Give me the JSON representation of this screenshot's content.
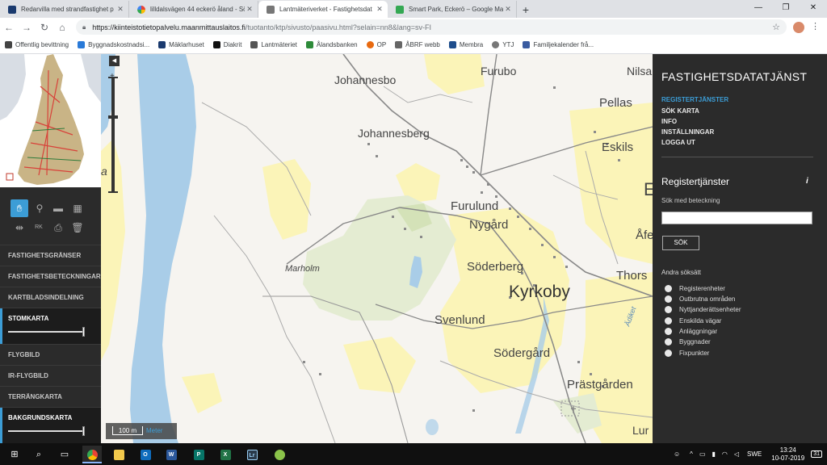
{
  "browser": {
    "tabs": [
      {
        "title": "Redarvilla med strandfastighet p",
        "fav_color": "#1a3a6e",
        "active": false
      },
      {
        "title": "lilldalsvägen 44 eckerö åland - Sö",
        "fav_color": "#ffffff",
        "active": false
      },
      {
        "title": "Lantmäteriverket - Fastighetsdat",
        "fav_color": "#555555",
        "active": true
      },
      {
        "title": "Smart Park, Eckerö – Google Ma",
        "fav_color": "#34a853",
        "active": false
      }
    ],
    "new_tab": "+",
    "url_host": "https://kiinteistotietopalvelu.maanmittauslaitos.fi",
    "url_path": "/tuotanto/ktp/sivusto/paasivu.html?selain=nn8&lang=sv-FI",
    "bookmarks": [
      {
        "label": "Offentlig bevittning",
        "color": "#444444"
      },
      {
        "label": "Byggnadskostnadsi...",
        "color": "#2a7ad8"
      },
      {
        "label": "Mäklarhuset",
        "color": "#1a3a6e"
      },
      {
        "label": "Diakrit",
        "color": "#111111"
      },
      {
        "label": "Lantmäteriet",
        "color": "#555555"
      },
      {
        "label": "Ålandsbanken",
        "color": "#2e8b3a"
      },
      {
        "label": "OP",
        "color": "#e86a10"
      },
      {
        "label": "ÅBRF webb",
        "color": "#666666"
      },
      {
        "label": "Membra",
        "color": "#1e4d8c"
      },
      {
        "label": "YTJ",
        "color": "#777777"
      },
      {
        "label": "Familjekalender frå...",
        "color": "#3a5ba0"
      }
    ]
  },
  "left_panel": {
    "layers": [
      {
        "label": "FASTIGHETSGRÄNSER",
        "on": false
      },
      {
        "label": "FASTIGHETSBETECKNINGAR",
        "on": false
      },
      {
        "label": "KARTBLADSINDELNING",
        "on": false
      },
      {
        "label": "STOMKARTA",
        "on": true
      },
      {
        "label": "FLYGBILD",
        "on": false
      },
      {
        "label": "IR-FLYGBILD",
        "on": false
      },
      {
        "label": "TERRÄNGKARTA",
        "on": false
      },
      {
        "label": "BAKGRUNDSKARTA",
        "on": true
      }
    ],
    "tool_rk": "RK"
  },
  "map": {
    "places": [
      {
        "name": "Johannesbo",
        "style": "normal"
      },
      {
        "name": "Furubo",
        "style": "normal"
      },
      {
        "name": "Nilsa",
        "style": "normal"
      },
      {
        "name": "Pellas",
        "style": "normal"
      },
      {
        "name": "Johannesberg",
        "style": "normal"
      },
      {
        "name": "Eskils",
        "style": "normal"
      },
      {
        "name": "Furulund",
        "style": "normal"
      },
      {
        "name": "Nygård",
        "style": "normal"
      },
      {
        "name": "Åfe",
        "style": "normal"
      },
      {
        "name": "Marholm",
        "style": "italic"
      },
      {
        "name": "Söderberg",
        "style": "normal"
      },
      {
        "name": "Thors",
        "style": "normal"
      },
      {
        "name": "Kyrkoby",
        "style": "big"
      },
      {
        "name": "Svenlund",
        "style": "normal"
      },
      {
        "name": "Södergård",
        "style": "normal"
      },
      {
        "name": "Prästgården",
        "style": "normal"
      },
      {
        "name": "Lur",
        "style": "normal"
      },
      {
        "name": "a",
        "style": "normal"
      },
      {
        "name": "E",
        "style": "normal"
      },
      {
        "name": "Ädiket",
        "style": "italic"
      }
    ],
    "scale_label": "100 m",
    "scale_unit": "Meter"
  },
  "right_panel": {
    "title": "FASTIGHETSDATATJÄNST",
    "menu": [
      {
        "label": "REGISTERTJÄNSTER",
        "active": true
      },
      {
        "label": "SÖK KARTA",
        "active": false
      },
      {
        "label": "INFO",
        "active": false
      },
      {
        "label": "INSTÄLLNINGAR",
        "active": false
      },
      {
        "label": "LOGGA UT",
        "active": false
      }
    ],
    "section_title": "Registertjänster",
    "info_glyph": "i",
    "search_label": "Sök med beteckning",
    "search_value": "",
    "search_button": "SÖK",
    "other_title": "Andra söksätt",
    "options": [
      "Registerenheter",
      "Outbrutna områden",
      "Nyttjanderättsenheter",
      "Enskilda vägar",
      "Anläggningar",
      "Byggnader",
      "Fixpunkter"
    ]
  },
  "taskbar": {
    "lang": "SWE",
    "time": "13:24",
    "date": "10-07-2019",
    "notif_count": "31",
    "apps": [
      {
        "name": "start-icon",
        "label": "⊞"
      },
      {
        "name": "search-icon",
        "label": "⌕"
      },
      {
        "name": "task-view-icon",
        "label": "▭"
      },
      {
        "name": "chrome-icon",
        "label": "◉",
        "active": true
      },
      {
        "name": "file-explorer-icon",
        "label": "▬"
      },
      {
        "name": "outlook-icon",
        "label": "O"
      },
      {
        "name": "word-icon",
        "label": "W"
      },
      {
        "name": "publisher-icon",
        "label": "P"
      },
      {
        "name": "excel-icon",
        "label": "X"
      },
      {
        "name": "lightroom-icon",
        "label": "Lr"
      },
      {
        "name": "app-icon",
        "label": "●"
      }
    ]
  },
  "colors": {
    "accent": "#3c9dd6",
    "panel": "#2b2b2b",
    "water": "#a9cde8",
    "field": "#fbf4b8",
    "forest": "#e4ecd2"
  }
}
